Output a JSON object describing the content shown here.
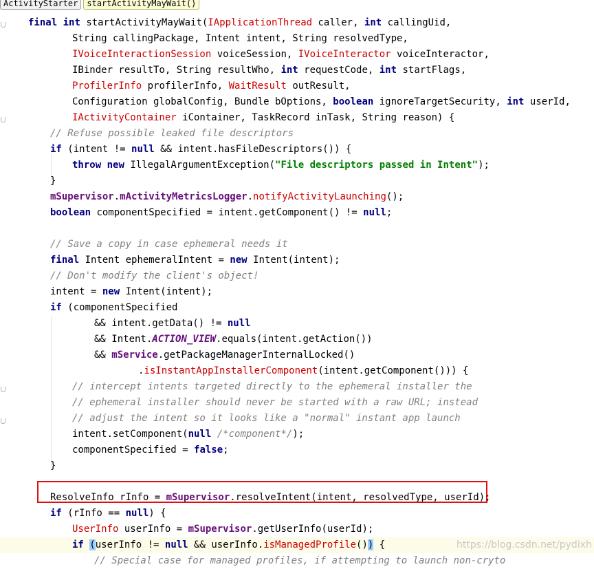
{
  "breadcrumb": {
    "class_name": "ActivityStarter",
    "method_name": "startActivityMayWait()"
  },
  "code": {
    "l1_final": "final",
    "l1_int": "int",
    "l1_name": "startActivityMayWait(",
    "l1_type": "IApplicationThread",
    "l1_mid": " caller, ",
    "l1_int2": "int",
    "l1_rest": " callingUid,",
    "l2": "String callingPackage, Intent intent, String resolvedType,",
    "l3_t1": "IVoiceInteractionSession",
    "l3_mid": " voiceSession, ",
    "l3_t2": "IVoiceInteractor",
    "l3_rest": " voiceInteractor,",
    "l4_a": "IBinder resultTo, String resultWho, ",
    "l4_int": "int",
    "l4_b": " requestCode, ",
    "l4_int2": "int",
    "l4_c": " startFlags,",
    "l5_t1": "ProfilerInfo",
    "l5_mid": " profilerInfo, ",
    "l5_t2": "WaitResult",
    "l5_rest": " outResult,",
    "l6_a": "Configuration globalConfig, Bundle bOptions, ",
    "l6_bool": "boolean",
    "l6_b": " ignoreTargetSecurity, ",
    "l6_int": "int",
    "l6_c": " userId,",
    "l7_t": "IActivityContainer",
    "l7_rest": " iContainer, TaskRecord inTask, String reason) {",
    "l8": "// Refuse possible leaked file descriptors",
    "l9_if": "if",
    "l9_a": " (intent != ",
    "l9_null": "null",
    "l9_b": " && intent.hasFileDescriptors()) {",
    "l10_throw": "throw",
    "l10_new": "new",
    "l10_a": " IllegalArgumentException(",
    "l10_str": "\"File descriptors passed in Intent\"",
    "l10_b": ");",
    "l11": "}",
    "l12_f1": "mSupervisor",
    "l12_dot": ".",
    "l12_f2": "mActivityMetricsLogger",
    "l12_dot2": ".",
    "l12_m": "notifyActivityLaunching",
    "l12_rest": "();",
    "l13_bool": "boolean",
    "l13_a": " componentSpecified = intent.getComponent() != ",
    "l13_null": "null",
    "l13_b": ";",
    "l15": "// Save a copy in case ephemeral needs it",
    "l16_final": "final",
    "l16_a": " Intent ephemeralIntent = ",
    "l16_new": "new",
    "l16_b": " Intent(intent);",
    "l17": "// Don't modify the client's object!",
    "l18_a": "intent = ",
    "l18_new": "new",
    "l18_b": " Intent(intent);",
    "l19_if": "if",
    "l19_a": " (componentSpecified",
    "l20_a": "&& intent.getData() != ",
    "l20_null": "null",
    "l21_a": "&& Intent.",
    "l21_sf": "ACTION_VIEW",
    "l21_b": ".equals(intent.getAction())",
    "l22_a": "&& ",
    "l22_f": "mService",
    "l22_b": ".getPackageManagerInternalLocked()",
    "l23_a": ".",
    "l23_m": "isInstantAppInstallerComponent",
    "l23_b": "(intent.getComponent())) {",
    "l24": "// intercept intents targeted directly to the ephemeral installer the",
    "l25": "// ephemeral installer should never be started with a raw URL; instead",
    "l26": "// adjust the intent so it looks like a \"normal\" instant app launch",
    "l27_a": "intent.setComponent(",
    "l27_null": "null",
    "l27_c": " /*component*/",
    "l27_b": ");",
    "l28_a": "componentSpecified = ",
    "l28_false": "false",
    "l28_b": ";",
    "l29": "}",
    "l31_a": "ResolveInfo rInfo = ",
    "l31_f": "mSupervisor",
    "l31_b": ".resolveIntent(intent, resolvedType, userId);",
    "l32_if": "if",
    "l32_a": " (rInfo == ",
    "l32_null": "null",
    "l32_b": ") {",
    "l33_t": "UserInfo",
    "l33_a": " userInfo = ",
    "l33_f": "mSupervisor",
    "l33_b": ".getUserInfo(userId);",
    "l34_if": "if",
    "l34_p": "(",
    "l34_a": "userInfo != ",
    "l34_null": "null",
    "l34_b": " && userInfo.",
    "l34_m": "isManagedProfile",
    "l34_p2": "()",
    "l34_p3": ")",
    "l34_c": " {",
    "l35": "// Special case for managed profiles, if attempting to launch non-cryto"
  },
  "watermark": "https://blog.csdn.net/pydixh"
}
